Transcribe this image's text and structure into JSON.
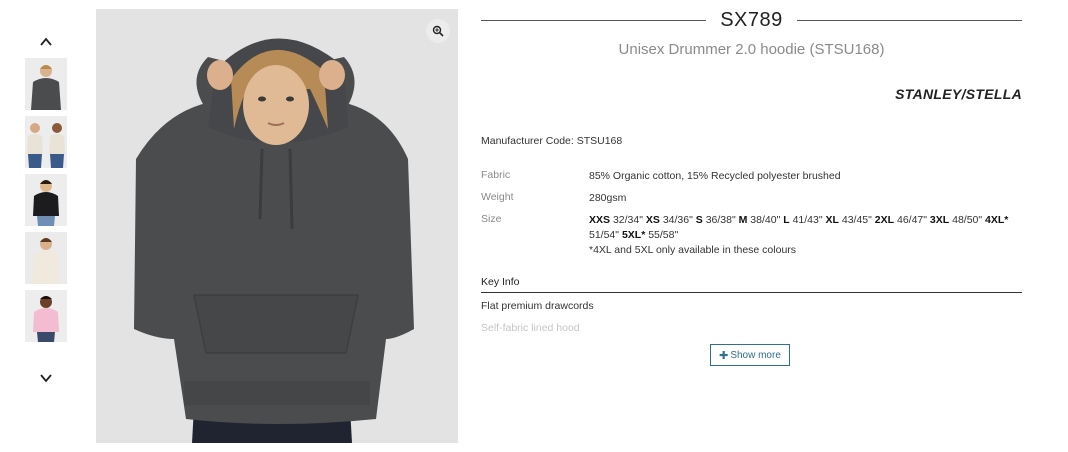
{
  "product": {
    "sku": "SX789",
    "name": "Unisex Drummer 2.0 hoodie (STSU168)",
    "brand": "STANLEY/STELLA",
    "manufacturer_code": "Manufacturer Code: STSU168"
  },
  "gallery": {
    "thumbnails": [
      {
        "label": "Model in dark grey hoodie",
        "color": "#4a4c4e"
      },
      {
        "label": "Two models in light hoodies",
        "color": "#e9e2d6"
      },
      {
        "label": "Model in black hoodie",
        "color": "#1c1c1e"
      },
      {
        "label": "Model in cream hoodie",
        "color": "#efe9de"
      },
      {
        "label": "Model in pink hoodie",
        "color": "#f3bcd0"
      }
    ],
    "main_color": "#4a4c4e",
    "zoom_icon": "zoom-in-icon",
    "up_icon": "chevron-up-icon",
    "down_icon": "chevron-down-icon"
  },
  "specs": {
    "fabric_label": "Fabric",
    "fabric_value": "85% Organic cotton, 15% Recycled polyester brushed",
    "weight_label": "Weight",
    "weight_value": "280gsm",
    "size_label": "Size",
    "sizes": [
      {
        "size": "XXS",
        "measure": "32/34\""
      },
      {
        "size": "XS",
        "measure": "34/36\""
      },
      {
        "size": "S",
        "measure": "36/38\""
      },
      {
        "size": "M",
        "measure": "38/40\""
      },
      {
        "size": "L",
        "measure": "41/43\""
      },
      {
        "size": "XL",
        "measure": "43/45\""
      },
      {
        "size": "2XL",
        "measure": "46/47\""
      },
      {
        "size": "3XL",
        "measure": "48/50\""
      },
      {
        "size": "4XL*",
        "measure": "51/54\""
      },
      {
        "size": "5XL*",
        "measure": "55/58\""
      }
    ],
    "size_note": "*4XL and 5XL only available in these colours"
  },
  "key_info": {
    "heading": "Key Info",
    "items": [
      "Flat premium drawcords",
      "Self-fabric lined hood"
    ],
    "show_more_label": "Show more",
    "show_more_icon": "plus-icon"
  },
  "colors": {
    "accent": "#2f6f8f",
    "muted_text": "#8a8a8a"
  }
}
